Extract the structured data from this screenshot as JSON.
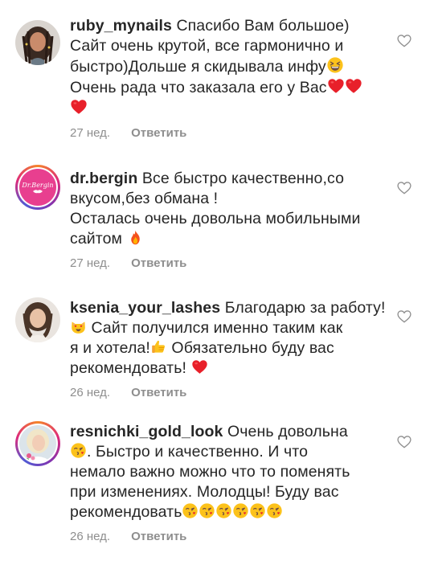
{
  "comments": [
    {
      "username": "ruby_mynails",
      "lines": [
        "Спасибо Вам большое)",
        "Сайт очень крутой, все гармонично и",
        "быстро)Дольше я скидывала инфу",
        "Очень рада что заказала его у Вас"
      ],
      "time": "27 нед.",
      "reply": "Ответить"
    },
    {
      "username": "dr.bergin",
      "lines": [
        "Все быстро качественно,со",
        "вкусом,без обмана !",
        "Осталась очень довольна мобильными",
        "сайтом"
      ],
      "time": "27 нед.",
      "reply": "Ответить",
      "logo_text": "Dr.Bergin"
    },
    {
      "username": "ksenia_your_lashes",
      "lines": [
        "Благодарю за работу!",
        "Сайт получился именно таким как",
        "я и хотела!",
        "Обязательно буду вас",
        "рекомендовать!"
      ],
      "time": "26 нед.",
      "reply": "Ответить"
    },
    {
      "username": "resnichki_gold_look",
      "lines": [
        "Очень довольна",
        ". Быстро и качественно. И что",
        "немало важно можно что то поменять",
        "при изменениях. Молодцы! Буду вас",
        "рекомендовать"
      ],
      "time": "26 нед.",
      "reply": "Ответить"
    }
  ],
  "icons": {
    "like": "heart-outline-icon",
    "heart": "red-heart-emoji",
    "fire": "fire-emoji",
    "cat": "heart-eyes-cat-emoji",
    "thumb": "thumbs-up-emoji",
    "kiss": "kissing-face-emoji",
    "laugh": "grinning-squint-emoji"
  },
  "colors": {
    "text": "#262626",
    "meta": "#8e8e8e",
    "heart": "#e8202a"
  }
}
